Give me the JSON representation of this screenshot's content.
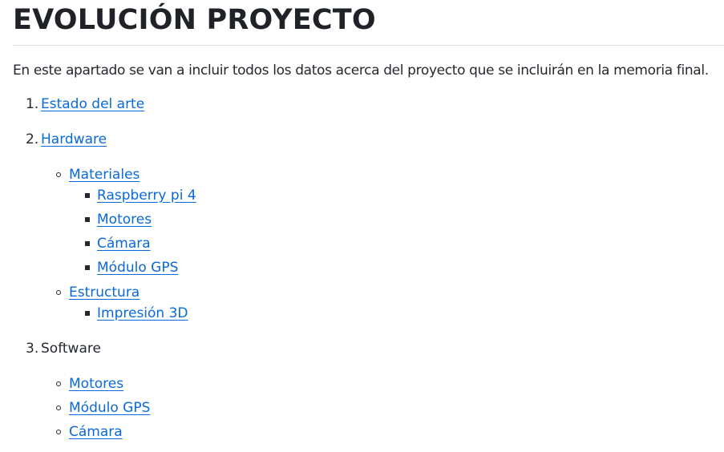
{
  "page": {
    "title": "EVOLUCIÓN PROYECTO",
    "intro": "En este apartado se van a incluir todos los datos acerca del proyecto que se incluirán en la memoria final."
  },
  "list": {
    "items": [
      {
        "number": "1.",
        "label": "Estado del arte"
      },
      {
        "number": "2.",
        "label": "Hardware",
        "children": [
          {
            "label": "Materiales",
            "children": [
              {
                "label": "Raspberry pi 4"
              },
              {
                "label": "Motores"
              },
              {
                "label": "Cámara"
              },
              {
                "label": "Módulo GPS"
              }
            ]
          },
          {
            "label": "Estructura",
            "children": [
              {
                "label": "Impresión 3D"
              }
            ]
          }
        ]
      },
      {
        "number": "3.",
        "label": "Software",
        "children": [
          {
            "label": "Motores"
          },
          {
            "label": "Módulo GPS"
          },
          {
            "label": "Cámara"
          }
        ]
      }
    ]
  },
  "colors": {
    "link": "#0969da",
    "text": "#24292f",
    "rule": "#d8dee4"
  }
}
